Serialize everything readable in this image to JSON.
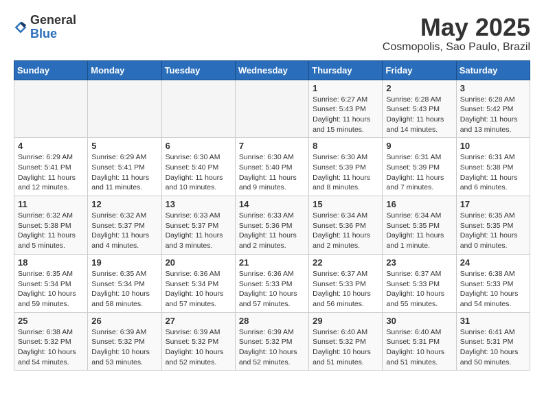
{
  "header": {
    "logo_general": "General",
    "logo_blue": "Blue",
    "month_title": "May 2025",
    "location": "Cosmopolis, Sao Paulo, Brazil"
  },
  "weekdays": [
    "Sunday",
    "Monday",
    "Tuesday",
    "Wednesday",
    "Thursday",
    "Friday",
    "Saturday"
  ],
  "weeks": [
    [
      {
        "day": "",
        "info": ""
      },
      {
        "day": "",
        "info": ""
      },
      {
        "day": "",
        "info": ""
      },
      {
        "day": "",
        "info": ""
      },
      {
        "day": "1",
        "info": "Sunrise: 6:27 AM\nSunset: 5:43 PM\nDaylight: 11 hours and 15 minutes."
      },
      {
        "day": "2",
        "info": "Sunrise: 6:28 AM\nSunset: 5:43 PM\nDaylight: 11 hours and 14 minutes."
      },
      {
        "day": "3",
        "info": "Sunrise: 6:28 AM\nSunset: 5:42 PM\nDaylight: 11 hours and 13 minutes."
      }
    ],
    [
      {
        "day": "4",
        "info": "Sunrise: 6:29 AM\nSunset: 5:41 PM\nDaylight: 11 hours and 12 minutes."
      },
      {
        "day": "5",
        "info": "Sunrise: 6:29 AM\nSunset: 5:41 PM\nDaylight: 11 hours and 11 minutes."
      },
      {
        "day": "6",
        "info": "Sunrise: 6:30 AM\nSunset: 5:40 PM\nDaylight: 11 hours and 10 minutes."
      },
      {
        "day": "7",
        "info": "Sunrise: 6:30 AM\nSunset: 5:40 PM\nDaylight: 11 hours and 9 minutes."
      },
      {
        "day": "8",
        "info": "Sunrise: 6:30 AM\nSunset: 5:39 PM\nDaylight: 11 hours and 8 minutes."
      },
      {
        "day": "9",
        "info": "Sunrise: 6:31 AM\nSunset: 5:39 PM\nDaylight: 11 hours and 7 minutes."
      },
      {
        "day": "10",
        "info": "Sunrise: 6:31 AM\nSunset: 5:38 PM\nDaylight: 11 hours and 6 minutes."
      }
    ],
    [
      {
        "day": "11",
        "info": "Sunrise: 6:32 AM\nSunset: 5:38 PM\nDaylight: 11 hours and 5 minutes."
      },
      {
        "day": "12",
        "info": "Sunrise: 6:32 AM\nSunset: 5:37 PM\nDaylight: 11 hours and 4 minutes."
      },
      {
        "day": "13",
        "info": "Sunrise: 6:33 AM\nSunset: 5:37 PM\nDaylight: 11 hours and 3 minutes."
      },
      {
        "day": "14",
        "info": "Sunrise: 6:33 AM\nSunset: 5:36 PM\nDaylight: 11 hours and 2 minutes."
      },
      {
        "day": "15",
        "info": "Sunrise: 6:34 AM\nSunset: 5:36 PM\nDaylight: 11 hours and 2 minutes."
      },
      {
        "day": "16",
        "info": "Sunrise: 6:34 AM\nSunset: 5:35 PM\nDaylight: 11 hours and 1 minute."
      },
      {
        "day": "17",
        "info": "Sunrise: 6:35 AM\nSunset: 5:35 PM\nDaylight: 11 hours and 0 minutes."
      }
    ],
    [
      {
        "day": "18",
        "info": "Sunrise: 6:35 AM\nSunset: 5:34 PM\nDaylight: 10 hours and 59 minutes."
      },
      {
        "day": "19",
        "info": "Sunrise: 6:35 AM\nSunset: 5:34 PM\nDaylight: 10 hours and 58 minutes."
      },
      {
        "day": "20",
        "info": "Sunrise: 6:36 AM\nSunset: 5:34 PM\nDaylight: 10 hours and 57 minutes."
      },
      {
        "day": "21",
        "info": "Sunrise: 6:36 AM\nSunset: 5:33 PM\nDaylight: 10 hours and 57 minutes."
      },
      {
        "day": "22",
        "info": "Sunrise: 6:37 AM\nSunset: 5:33 PM\nDaylight: 10 hours and 56 minutes."
      },
      {
        "day": "23",
        "info": "Sunrise: 6:37 AM\nSunset: 5:33 PM\nDaylight: 10 hours and 55 minutes."
      },
      {
        "day": "24",
        "info": "Sunrise: 6:38 AM\nSunset: 5:33 PM\nDaylight: 10 hours and 54 minutes."
      }
    ],
    [
      {
        "day": "25",
        "info": "Sunrise: 6:38 AM\nSunset: 5:32 PM\nDaylight: 10 hours and 54 minutes."
      },
      {
        "day": "26",
        "info": "Sunrise: 6:39 AM\nSunset: 5:32 PM\nDaylight: 10 hours and 53 minutes."
      },
      {
        "day": "27",
        "info": "Sunrise: 6:39 AM\nSunset: 5:32 PM\nDaylight: 10 hours and 52 minutes."
      },
      {
        "day": "28",
        "info": "Sunrise: 6:39 AM\nSunset: 5:32 PM\nDaylight: 10 hours and 52 minutes."
      },
      {
        "day": "29",
        "info": "Sunrise: 6:40 AM\nSunset: 5:32 PM\nDaylight: 10 hours and 51 minutes."
      },
      {
        "day": "30",
        "info": "Sunrise: 6:40 AM\nSunset: 5:31 PM\nDaylight: 10 hours and 51 minutes."
      },
      {
        "day": "31",
        "info": "Sunrise: 6:41 AM\nSunset: 5:31 PM\nDaylight: 10 hours and 50 minutes."
      }
    ]
  ]
}
